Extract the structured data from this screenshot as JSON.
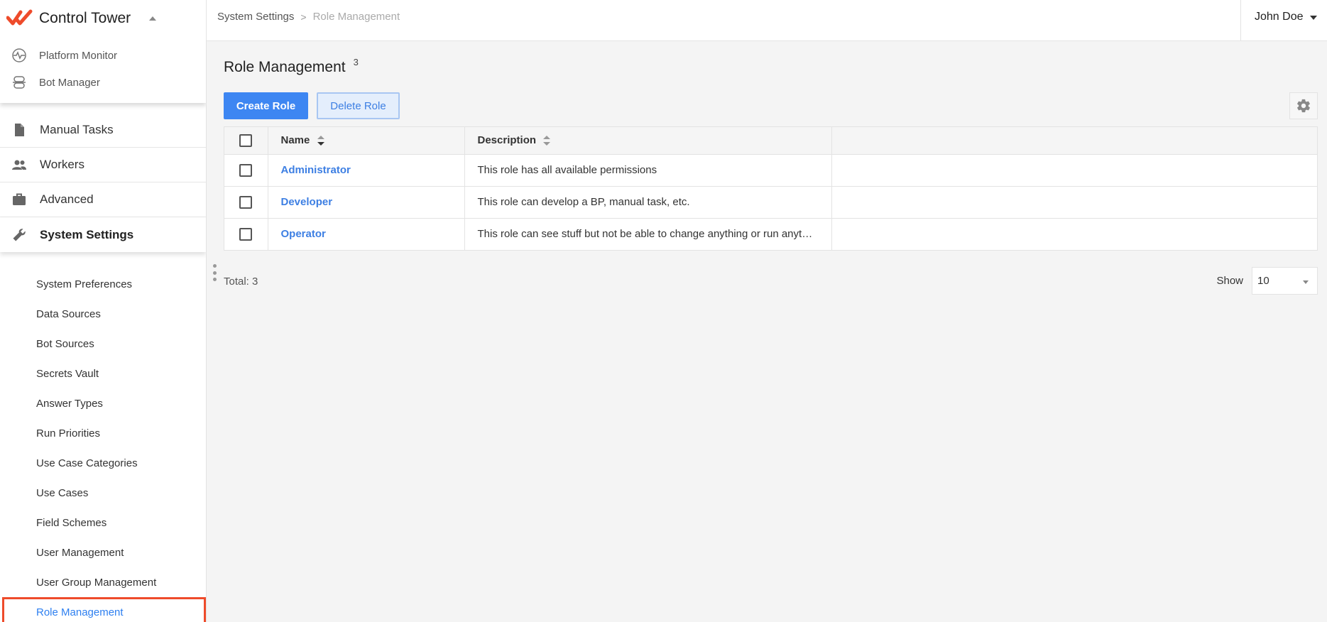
{
  "app": {
    "title": "Control Tower",
    "accent_color": "#ee4b2b",
    "link_color": "#3d7fe3"
  },
  "modules": [
    {
      "label": "Platform Monitor",
      "icon": "pulse-icon"
    },
    {
      "label": "Bot Manager",
      "icon": "bot-icon"
    }
  ],
  "nav": {
    "items": [
      {
        "label": "Manual Tasks",
        "icon": "document-icon"
      },
      {
        "label": "Workers",
        "icon": "people-icon"
      },
      {
        "label": "Advanced",
        "icon": "briefcase-icon"
      },
      {
        "label": "System Settings",
        "icon": "wrench-icon"
      }
    ],
    "subitems": [
      "System Preferences",
      "Data Sources",
      "Bot Sources",
      "Secrets Vault",
      "Answer Types",
      "Run Priorities",
      "Use Case Categories",
      "Use Cases",
      "Field Schemes",
      "User Management",
      "User Group Management",
      "Role Management"
    ]
  },
  "breadcrumb": {
    "parent": "System Settings",
    "separator": ">",
    "current": "Role Management"
  },
  "user": {
    "name": "John Doe"
  },
  "page": {
    "title": "Role Management",
    "count": "3"
  },
  "toolbar": {
    "create_label": "Create Role",
    "delete_label": "Delete Role"
  },
  "table": {
    "columns": [
      "Name",
      "Description"
    ],
    "rows": [
      {
        "name": "Administrator",
        "description": "This role has all available permissions"
      },
      {
        "name": "Developer",
        "description": "This role can develop a BP, manual task, etc."
      },
      {
        "name": "Operator",
        "description": "This role can see stuff but not be able to change anything or run anything"
      }
    ]
  },
  "footer": {
    "total_label": "Total: 3",
    "show_label": "Show",
    "page_size": "10"
  }
}
